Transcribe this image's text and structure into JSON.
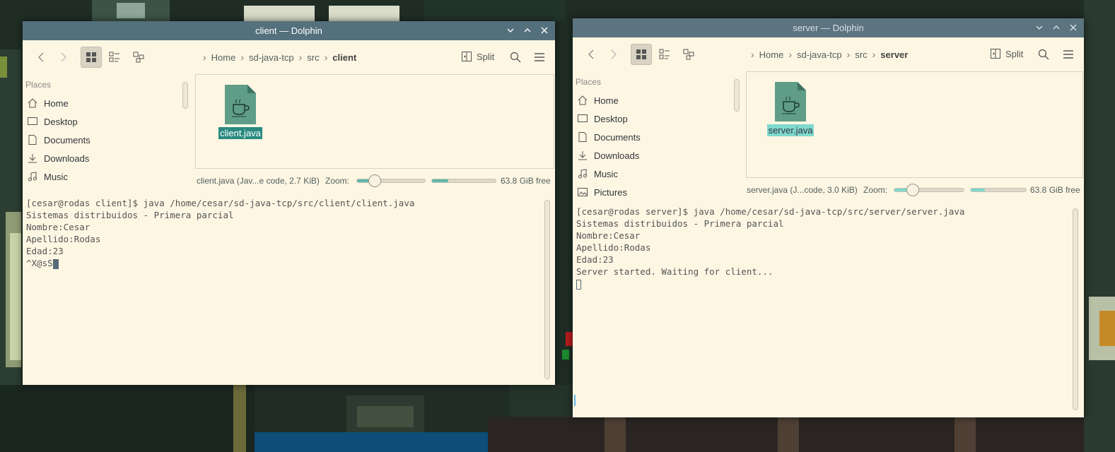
{
  "left_window": {
    "title": "client — Dolphin",
    "breadcrumbs": [
      "Home",
      "sd-java-tcp",
      "src",
      "client"
    ],
    "split_label": "Split",
    "places_header": "Places",
    "places": [
      {
        "label": "Home",
        "icon": "home-icon"
      },
      {
        "label": "Desktop",
        "icon": "desktop-icon"
      },
      {
        "label": "Documents",
        "icon": "documents-icon"
      },
      {
        "label": "Downloads",
        "icon": "downloads-icon"
      },
      {
        "label": "Music",
        "icon": "music-icon"
      }
    ],
    "file": {
      "name": "client.java",
      "icon": "java-file-icon",
      "selected": true
    },
    "status_text": "client.java (Jav...e code, 2.7 KiB)",
    "zoom_label": "Zoom:",
    "zoom_level": 0.27,
    "free_space_fill": 0.25,
    "free_space": "63.8 GiB free",
    "terminal_lines": [
      "[cesar@rodas client]$ java /home/cesar/sd-java-tcp/src/client/client.java",
      "Sistemas distribuidos - Primera parcial",
      "Nombre:Cesar",
      "Apellido:Rodas",
      "Edad:23",
      "^X@sS"
    ]
  },
  "right_window": {
    "title": "server — Dolphin",
    "breadcrumbs": [
      "Home",
      "sd-java-tcp",
      "src",
      "server"
    ],
    "split_label": "Split",
    "places_header": "Places",
    "places": [
      {
        "label": "Home",
        "icon": "home-icon"
      },
      {
        "label": "Desktop",
        "icon": "desktop-icon"
      },
      {
        "label": "Documents",
        "icon": "documents-icon"
      },
      {
        "label": "Downloads",
        "icon": "downloads-icon"
      },
      {
        "label": "Music",
        "icon": "music-icon"
      },
      {
        "label": "Pictures",
        "icon": "pictures-icon"
      }
    ],
    "file": {
      "name": "server.java",
      "icon": "java-file-icon",
      "selected": true
    },
    "status_text": "server.java (J...code, 3.0 KiB)",
    "zoom_label": "Zoom:",
    "zoom_level": 0.27,
    "free_space_fill": 0.25,
    "free_space": "63.8 GiB free",
    "terminal_lines": [
      "[cesar@rodas server]$ java /home/cesar/sd-java-tcp/src/server/server.java",
      "Sistemas distribuidos - Primera parcial",
      "Nombre:Cesar",
      "Apellido:Rodas",
      "Edad:23",
      "Server started. Waiting for client..."
    ]
  },
  "colors": {
    "titlebar": "#54707c",
    "window_bg": "#fdf6e3",
    "selection_active": "#2a8a80",
    "selection_inactive": "#7fd8cc",
    "accent": "#5fb8a8"
  }
}
